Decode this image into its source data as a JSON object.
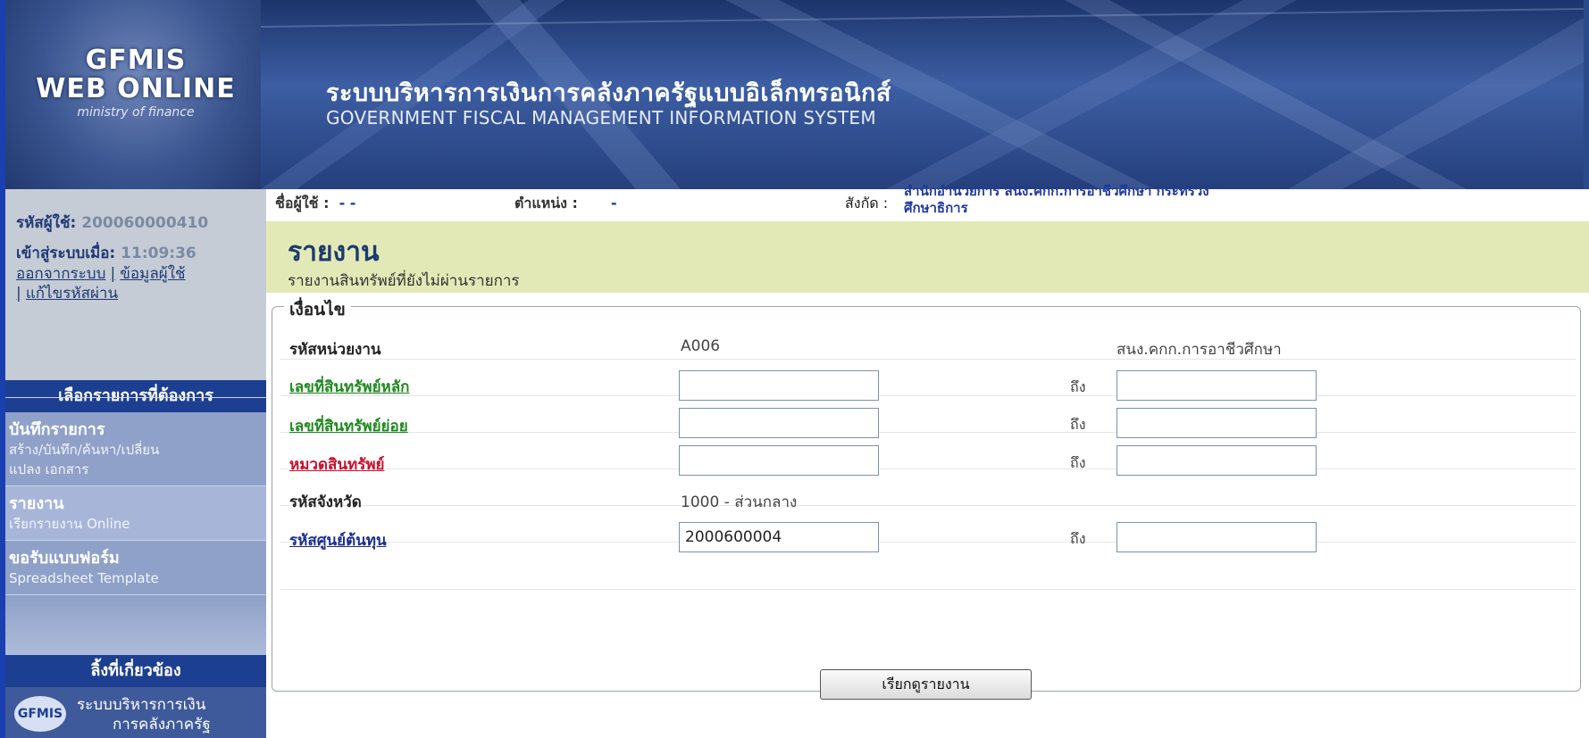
{
  "header": {
    "logo_line1": "GFMIS",
    "logo_line2": "WEB ONLINE",
    "logo_sub": "ministry of finance",
    "title_thai": "ระบบบริหารการเงินการคลังภาครัฐแบบอิเล็กทรอนิกส์",
    "title_en": "GOVERNMENT FISCAL MANAGEMENT INFORMATION SYSTEM"
  },
  "user": {
    "id_label": "รหัสผู้ใช้:",
    "id_value": "200060000410",
    "login_label": "เข้าสู่ระบบเมื่อ:",
    "login_time": "11:09:36",
    "logout_link": "ออกจากระบบ",
    "userinfo_link": "ข้อมูลผู้ใช้",
    "changepw_link": "แก้ไขรหัสผ่าน",
    "separator": "|"
  },
  "sidebar": {
    "menu_header": "เลือกรายการที่ต้องการ",
    "items": [
      {
        "title": "บันทึกรายการ",
        "desc1": "สร้าง/บันทึก/ค้นหา/เปลี่ยน",
        "desc2": "แปลง เอกสาร"
      },
      {
        "title": "รายงาน",
        "desc1": "เรียกรายงาน Online",
        "desc2": ""
      },
      {
        "title": "ขอรับแบบฟอร์ม",
        "desc1": "Spreadsheet Template",
        "desc2": ""
      }
    ],
    "links_header": "ลิ้งที่เกี่ยวข้อง",
    "gfmis_badge": "GFMIS",
    "gfmis_text1": "ระบบบริหารการเงิน",
    "gfmis_text2": "การคลังภาครัฐ"
  },
  "info_bar": {
    "username_label": "ชื่อผู้ใช้ :",
    "username_value": "- -",
    "position_label": "ตำแหน่ง :",
    "position_value": "-",
    "affiliation_label": "สังกัด :",
    "affiliation_line1": "สำนักอำนวยการ สนง.คกก.การอาชีวศึกษา กระทรวง",
    "affiliation_line2": "ศึกษาธิการ"
  },
  "report": {
    "title": "รายงาน",
    "subtitle": "รายงานสินทรัพย์ที่ยังไม่ผ่านรายการ"
  },
  "conditions": {
    "legend": "เงื่อนไข",
    "to_label": "ถึง",
    "unit_label": "รหัสหน่วยงาน",
    "unit_code": "A006",
    "unit_name": "สนง.คกก.การอาชีวศึกษา",
    "main_asset_label": "เลขที่สินทรัพย์หลัก",
    "main_asset_from": "",
    "main_asset_to": "",
    "sub_asset_label": "เลขที่สินทรัพย์ย่อย",
    "sub_asset_from": "",
    "sub_asset_to": "",
    "asset_class_label": "หมวดสินทรัพย์",
    "asset_class_from": "",
    "asset_class_to": "",
    "province_label": "รหัสจังหวัด",
    "province_value": "1000 - ส่วนกลาง",
    "cost_center_label": "รหัสศูนย์ต้นทุน",
    "cost_center_from": "2000600004",
    "cost_center_to": "",
    "submit_label": "เรียกดูรายงาน"
  },
  "colors": {
    "link_green": "#1f8a1f",
    "link_red": "#c8102e",
    "link_blue": "#1c2f8f"
  }
}
